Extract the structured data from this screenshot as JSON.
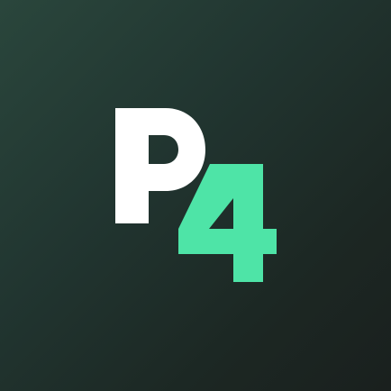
{
  "logo": {
    "text": "P4",
    "letter": "P",
    "digit": "4",
    "icon": "p4-logo-icon"
  },
  "colors": {
    "background_light": "#2a463c",
    "background_dark": "#1a201e",
    "letter": "#ffffff",
    "digit": "#4ee4a7"
  }
}
